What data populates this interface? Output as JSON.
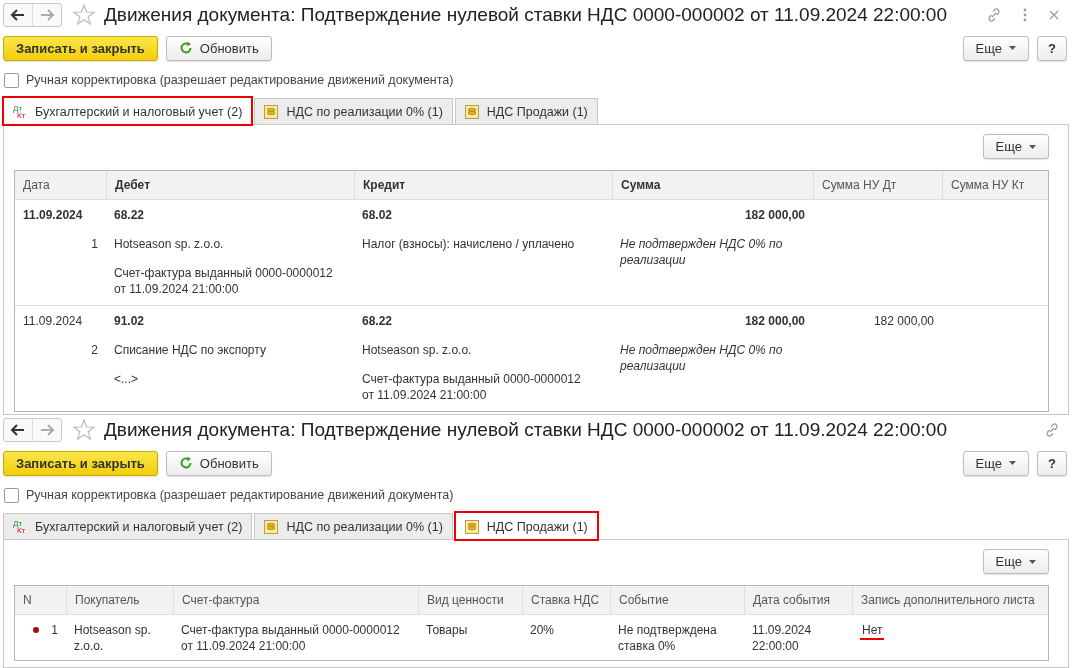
{
  "panels": [
    {
      "title": "Движения документа: Подтверждение нулевой ставки НДС 0000-000002 от 11.09.2024 22:00:00",
      "header_icons": [
        {
          "kind": "link"
        },
        {
          "kind": "more"
        },
        {
          "kind": "close"
        }
      ],
      "primary_button": "Записать и закрыть",
      "refresh_button": "Обновить",
      "more_button": "Еще",
      "help_button": "?",
      "manual_edit": {
        "label": "Ручная корректировка (разрешает редактирование движений документа)",
        "checked": false
      },
      "tabs": [
        {
          "label": "Бухгалтерский и налоговый учет (2)",
          "kind": "dtkt",
          "icon_top": "Дт",
          "icon_bottom": "Кт",
          "selected": true,
          "highlighted": true
        },
        {
          "label": "НДС по реализации 0% (1)",
          "kind": "register",
          "selected": false,
          "highlighted": false
        },
        {
          "label": "НДС Продажи (1)",
          "kind": "register",
          "selected": false,
          "highlighted": false
        }
      ],
      "table_more_button": "Еще",
      "table": {
        "kind": "entries",
        "columns": [
          {
            "label": "Дата",
            "bold": false
          },
          {
            "label": "Дебет",
            "bold": true
          },
          {
            "label": "Кредит",
            "bold": true
          },
          {
            "label": "Сумма",
            "bold": true
          },
          {
            "label": "Сумма НУ Дт",
            "bold": false
          },
          {
            "label": "Сумма НУ Кт",
            "bold": false
          }
        ],
        "rows": [
          {
            "selected": true,
            "date": "11.09.2024",
            "number": "1",
            "debit": {
              "account": "68.22",
              "lines": [
                "Hotseason sp. z.o.o.",
                "Счет-фактура выданный 0000-0000012 от 11.09.2024 21:00:00"
              ]
            },
            "credit": {
              "account": "68.02",
              "lines": [
                "Налог (взносы): начислено / уплачено"
              ]
            },
            "amount": "182 000,00",
            "amount_note": "Не подтвержден НДС 0% по реализации"
          },
          {
            "selected": false,
            "date": "11.09.2024",
            "number": "2",
            "debit": {
              "account": "91.02",
              "lines": [
                "Списание НДС по экспорту",
                "<...>"
              ]
            },
            "credit": {
              "account": "68.22",
              "lines": [
                "Hotseason sp. z.o.o.",
                "Счет-фактура выданный 0000-0000012 от 11.09.2024 21:00:00"
              ]
            },
            "amount": "182 000,00",
            "amount_note": "Не подтвержден НДС 0% по реализации",
            "amount_nu_dt": "182 000,00"
          }
        ]
      }
    },
    {
      "title": "Движения документа: Подтверждение нулевой ставки НДС 0000-000002 от 11.09.2024 22:00:00",
      "header_icons": [
        {
          "kind": "link"
        }
      ],
      "primary_button": "Записать и закрыть",
      "refresh_button": "Обновить",
      "more_button": "Еще",
      "help_button": "?",
      "manual_edit": {
        "label": "Ручная корректировка (разрешает редактирование движений документа)",
        "checked": false
      },
      "tabs": [
        {
          "label": "Бухгалтерский и налоговый учет (2)",
          "kind": "dtkt",
          "icon_top": "Дт",
          "icon_bottom": "Кт",
          "selected": false,
          "highlighted": false
        },
        {
          "label": "НДС по реализации 0% (1)",
          "kind": "register",
          "selected": false,
          "highlighted": false
        },
        {
          "label": "НДС Продажи (1)",
          "kind": "register",
          "selected": true,
          "highlighted": true
        }
      ],
      "table_more_button": "Еще",
      "table": {
        "kind": "sales",
        "columns": [
          {
            "label": "N",
            "bold": false
          },
          {
            "label": "Покупатель",
            "bold": false
          },
          {
            "label": "Счет-фактура",
            "bold": false
          },
          {
            "label": "Вид ценности",
            "bold": false
          },
          {
            "label": "Ставка НДС",
            "bold": false
          },
          {
            "label": "Событие",
            "bold": false
          },
          {
            "label": "Дата события",
            "bold": false
          },
          {
            "label": "Запись дополнительного листа",
            "bold": false
          }
        ],
        "rows": [
          {
            "active": true,
            "cells": [
              {
                "text": "1",
                "underlined": false
              },
              {
                "text": "Hotseason sp. z.o.o.",
                "underlined": false
              },
              {
                "text": "Счет-фактура выданный 0000-0000012 от 11.09.2024 21:00:00",
                "underlined": false
              },
              {
                "text": "Товары",
                "underlined": false
              },
              {
                "text": "20%",
                "underlined": false
              },
              {
                "text": "Не подтверждена ставка 0%",
                "underlined": false
              },
              {
                "text": "11.09.2024 22:00:00",
                "underlined": false
              },
              {
                "text": "Нет",
                "underlined": true
              }
            ]
          }
        ]
      }
    }
  ]
}
